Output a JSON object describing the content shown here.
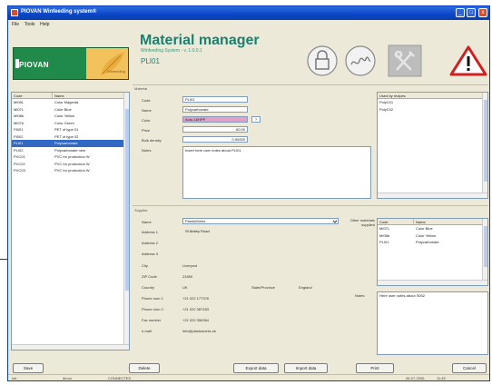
{
  "window": {
    "title": "PIOVAN Winfeeding system®",
    "controls": [
      "_",
      "□",
      "x"
    ]
  },
  "menu": [
    "File",
    "Tools",
    "Help"
  ],
  "logo": {
    "brand": "PIOVAN",
    "sub": "Winfeeding"
  },
  "app": {
    "title": "Material manager",
    "subtitle": "Winfeeding System - v. 1.0.0.1",
    "code": "PLI01"
  },
  "section_material": "Material",
  "materials": {
    "columns": [
      "Code",
      "Name"
    ],
    "rows": [
      [
        "MI05L",
        "Color Magenta"
      ],
      [
        "MI07L",
        "Color Blue"
      ],
      [
        "MI08b",
        "Color Yellow"
      ],
      [
        "MI07b",
        "Color Green"
      ],
      [
        "PI001",
        "PET of type 01"
      ],
      [
        "PI002",
        "PET of type 02"
      ],
      [
        "PLI01",
        "Polycarbonate"
      ],
      [
        "PLI02",
        "Polycarbonate new"
      ],
      [
        "PVC01",
        "PVC for production W"
      ],
      [
        "PVC02",
        "PVC for production W"
      ],
      [
        "PVC03",
        "PVC for production W"
      ]
    ],
    "selected_index": 6
  },
  "material_form": {
    "code_label": "Code",
    "code": "PLI01",
    "name_label": "Name",
    "name": "Polycarbonate",
    "color_label": "Color",
    "color": "Auto-16HPP",
    "color_btn": "?",
    "price_label": "Price",
    "price": "60.00",
    "density_label": "Bulk density",
    "density": "0.90000",
    "notes_label": "Notes",
    "notes": "Insert here user notes about PLI01"
  },
  "recipes": {
    "column": "Used by recipes",
    "rows": [
      "PolyC01",
      "PolyC02"
    ]
  },
  "section_supplier": "Supplier",
  "supplier_form": {
    "name_label": "Name",
    "name": "PlastoWorks",
    "addr1_label": "Address 1",
    "addr1": "St Abbey Road",
    "addr2_label": "Address 2",
    "addr3_label": "Address 3",
    "city_label": "City",
    "city": "Liverpool",
    "zip_label": "ZIP Code",
    "zip": "23450",
    "country_label": "Country",
    "country": "UK",
    "state_label": "State/Province",
    "state": "England",
    "phone1_label": "Phone num 1",
    "phone1": "+21 022 177376",
    "phone2_label": "Phone num 2",
    "phone2": "+21 022 387453",
    "fax_label": "Fax number",
    "fax": "+21 022 356364",
    "email_label": "e-mail",
    "email": "info@plastoworks.uk",
    "notes_label": "Notes",
    "notes": "Here user notes about S002"
  },
  "other_materials": {
    "label": "Other materials supplied",
    "columns": [
      "Code",
      "Name"
    ],
    "rows": [
      [
        "MI07L",
        "Color Blue"
      ],
      [
        "MI08b",
        "Color Yellow"
      ],
      [
        "PLI01",
        "Polycarbonate"
      ]
    ]
  },
  "buttons": {
    "save": "Save",
    "delete": "Delete",
    "export": "Export data",
    "import": "Import data",
    "print": "Print",
    "cancel": "Cancel"
  },
  "status": {
    "left": "Init",
    "user": "demo",
    "state": "CONNECTED",
    "date": "06-07-2006",
    "time": "11:45"
  }
}
